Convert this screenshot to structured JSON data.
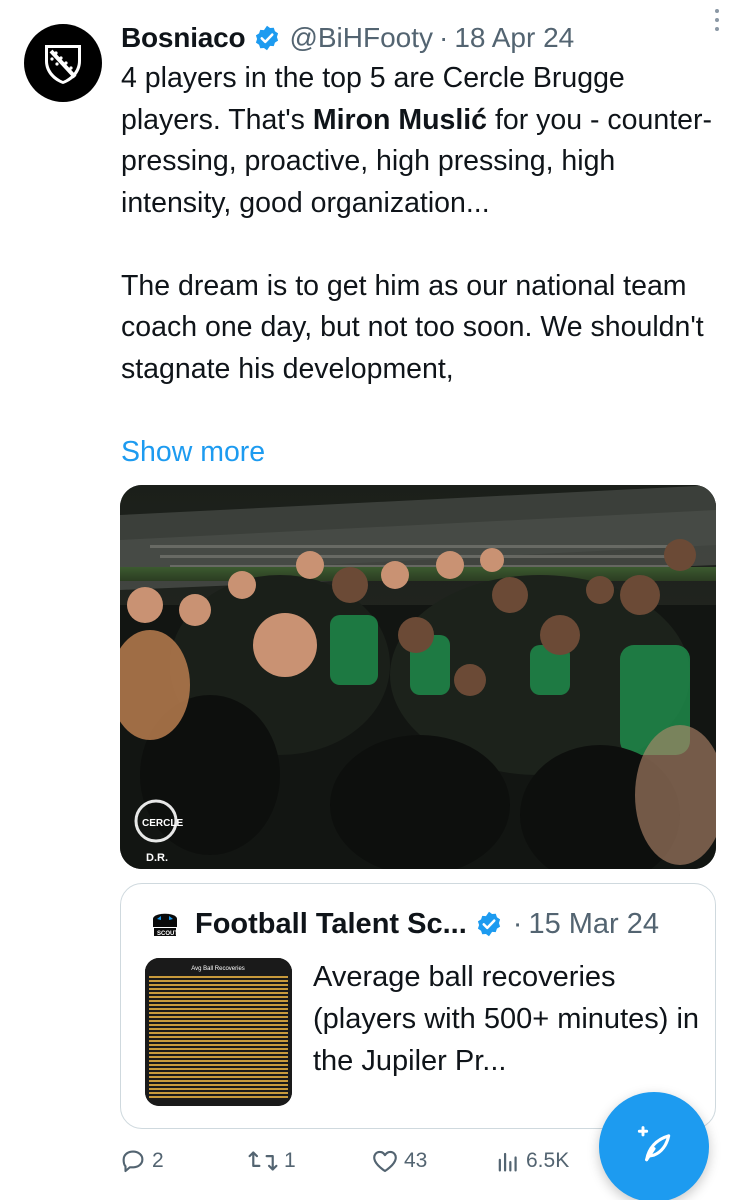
{
  "tweet": {
    "author_name": "Bosniaco",
    "handle": "@BiHFooty",
    "separator": "·",
    "date": "18 Apr 24",
    "text_before_bold": "4 players in the top 5 are Cercle Brugge players. That's ",
    "text_bold": "Miron Muslić",
    "text_after_bold": " for you - counter-pressing, proactive, high pressing, high intensity, good organization...\n\nThe dream is to get him as our national team coach one day, but not too soon. We shouldn't stagnate his development,",
    "show_more_label": "Show more",
    "photo_watermark": "D.R.",
    "photo_logo_text": "CERCLE"
  },
  "quoted_tweet": {
    "author_name": "Football Talent Sc...",
    "separator": "·",
    "date": "15 Mar 24",
    "thumbnail_title": "Avg Ball Recoveries",
    "text": "Average ball recoveries (players with 500+ minutes) in the Jupiler Pr..."
  },
  "actions": {
    "replies": "2",
    "retweets": "1",
    "likes": "43",
    "views": "6.5K"
  },
  "icons": {
    "verified": "verified-badge-icon",
    "more": "more-vertical-icon",
    "reply": "reply-icon",
    "retweet": "retweet-icon",
    "like": "heart-icon",
    "views": "views-chart-icon",
    "compose": "compose-feather-icon"
  },
  "colors": {
    "accent": "#1d9bf0",
    "text_primary": "#0f1419",
    "text_secondary": "#536471",
    "border": "#cfd9de"
  }
}
